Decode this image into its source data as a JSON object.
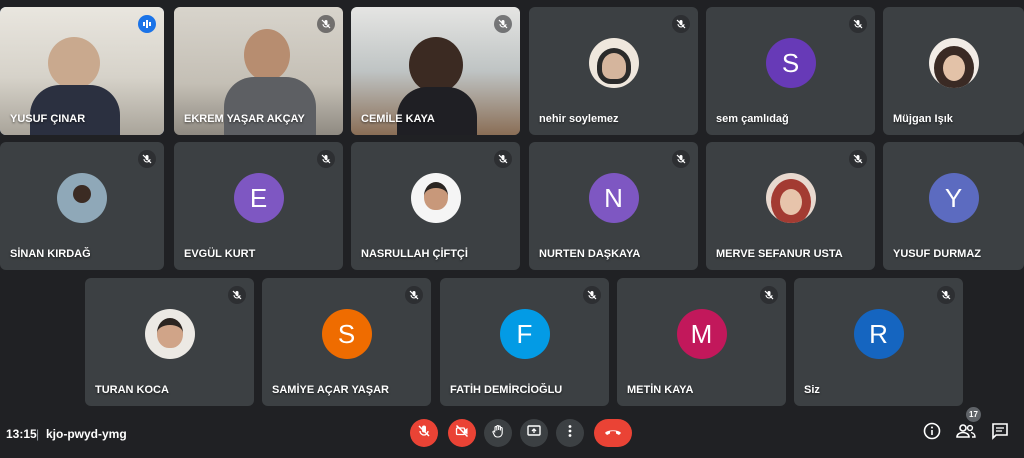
{
  "meeting": {
    "time": "13:15",
    "separator": "|",
    "code": "kjo-pwyd-ymg",
    "participants_count": "17"
  },
  "participants": [
    {
      "name": "YUSUF ÇINAR",
      "type": "video",
      "muted": false,
      "speaking": true
    },
    {
      "name": "EKREM YAŞAR AKÇAY",
      "type": "video",
      "muted": true
    },
    {
      "name": "CEMİLE KAYA",
      "type": "video",
      "muted": true
    },
    {
      "name": "nehir soylemez",
      "type": "photo",
      "muted": true
    },
    {
      "name": "sem çamlıdağ",
      "type": "initial",
      "initial": "S",
      "color": "#673ab7",
      "muted": true
    },
    {
      "name": "Müjgan Işık",
      "type": "photo",
      "muted": true
    },
    {
      "name": "SİNAN KIRDAĞ",
      "type": "photo",
      "muted": true
    },
    {
      "name": "EVGÜL KURT",
      "type": "initial",
      "initial": "E",
      "color": "#7e57c2",
      "muted": true
    },
    {
      "name": "NASRULLAH ÇİFTÇİ",
      "type": "photo",
      "muted": true
    },
    {
      "name": "NURTEN DAŞKAYA",
      "type": "initial",
      "initial": "N",
      "color": "#7e57c2",
      "muted": true
    },
    {
      "name": "MERVE SEFANUR USTA",
      "type": "photo",
      "muted": true
    },
    {
      "name": "YUSUF DURMAZ",
      "type": "initial",
      "initial": "Y",
      "color": "#5c6bc0",
      "muted": false
    },
    {
      "name": "TURAN KOCA",
      "type": "photo",
      "muted": true
    },
    {
      "name": "SAMİYE AÇAR YAŞAR",
      "type": "initial",
      "initial": "S",
      "color": "#ef6c00",
      "muted": true
    },
    {
      "name": "FATİH DEMİRCİOĞLU",
      "type": "initial",
      "initial": "F",
      "color": "#039be5",
      "muted": true
    },
    {
      "name": "METİN KAYA",
      "type": "initial",
      "initial": "M",
      "color": "#c2185b",
      "muted": true
    },
    {
      "name": "Siz",
      "type": "initial",
      "initial": "R",
      "color": "#1565c0",
      "muted": true
    }
  ],
  "controls": {
    "mic": "mic-off-icon",
    "camera": "camera-off-icon",
    "hand": "raise-hand-icon",
    "present": "present-screen-icon",
    "more": "more-options-icon",
    "leave": "end-call-icon",
    "info": "info-icon",
    "people": "people-icon",
    "chat": "chat-icon"
  },
  "colors": {
    "background": "#202124",
    "tile": "#3c4043",
    "danger": "#ea4335",
    "active_speaker": "#8ab4f8"
  }
}
